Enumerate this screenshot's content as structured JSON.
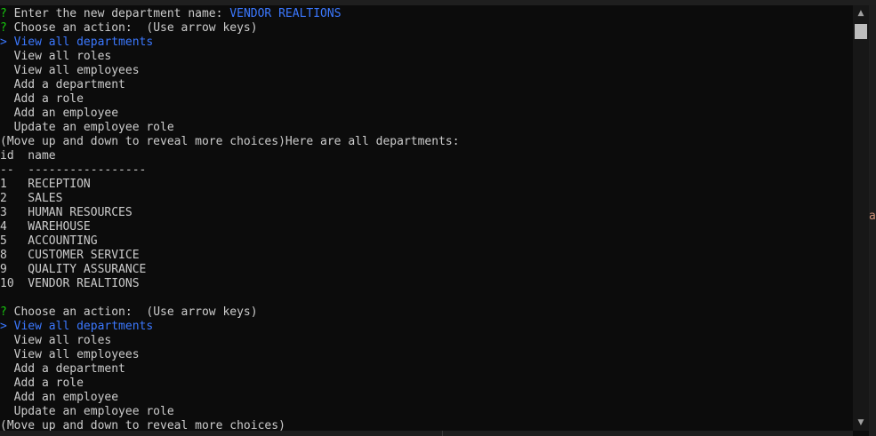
{
  "lines": [
    [
      {
        "t": "? ",
        "c": "g"
      },
      {
        "t": "Enter the new department name: "
      },
      {
        "t": "VENDOR REALTIONS",
        "c": "a"
      }
    ],
    [
      {
        "t": "? ",
        "c": "g"
      },
      {
        "t": "Choose an action:  (Use arrow keys)"
      }
    ],
    [
      {
        "t": "> View all departments",
        "c": "a"
      }
    ],
    [
      {
        "t": "  View all roles"
      }
    ],
    [
      {
        "t": "  View all employees"
      }
    ],
    [
      {
        "t": "  Add a department"
      }
    ],
    [
      {
        "t": "  Add a role"
      }
    ],
    [
      {
        "t": "  Add an employee"
      }
    ],
    [
      {
        "t": "  Update an employee role"
      }
    ],
    [
      {
        "t": "(Move up and down to reveal more choices)Here are all departments:"
      }
    ],
    [
      {
        "t": "id  name"
      }
    ],
    [
      {
        "t": "--  -----------------"
      }
    ],
    [
      {
        "t": "1   RECEPTION"
      }
    ],
    [
      {
        "t": "2   SALES"
      }
    ],
    [
      {
        "t": "3   HUMAN RESOURCES"
      }
    ],
    [
      {
        "t": "4   WAREHOUSE"
      }
    ],
    [
      {
        "t": "5   ACCOUNTING"
      }
    ],
    [
      {
        "t": "8   CUSTOMER SERVICE"
      }
    ],
    [
      {
        "t": "9   QUALITY ASSURANCE"
      }
    ],
    [
      {
        "t": "10  VENDOR REALTIONS"
      }
    ],
    [
      {
        "t": ""
      }
    ],
    [
      {
        "t": "? ",
        "c": "g"
      },
      {
        "t": "Choose an action:  (Use arrow keys)"
      }
    ],
    [
      {
        "t": "> View all departments",
        "c": "a"
      }
    ],
    [
      {
        "t": "  View all roles"
      }
    ],
    [
      {
        "t": "  View all employees"
      }
    ],
    [
      {
        "t": "  Add a department"
      }
    ],
    [
      {
        "t": "  Add a role"
      }
    ],
    [
      {
        "t": "  Add an employee"
      }
    ],
    [
      {
        "t": "  Update an employee role"
      }
    ],
    [
      {
        "t": "(Move up and down to reveal more choices)"
      }
    ]
  ],
  "scrollbar": {
    "up_icon": "triangle-up-icon",
    "down_icon": "triangle-down-icon"
  },
  "edge": {
    "char": "a"
  }
}
